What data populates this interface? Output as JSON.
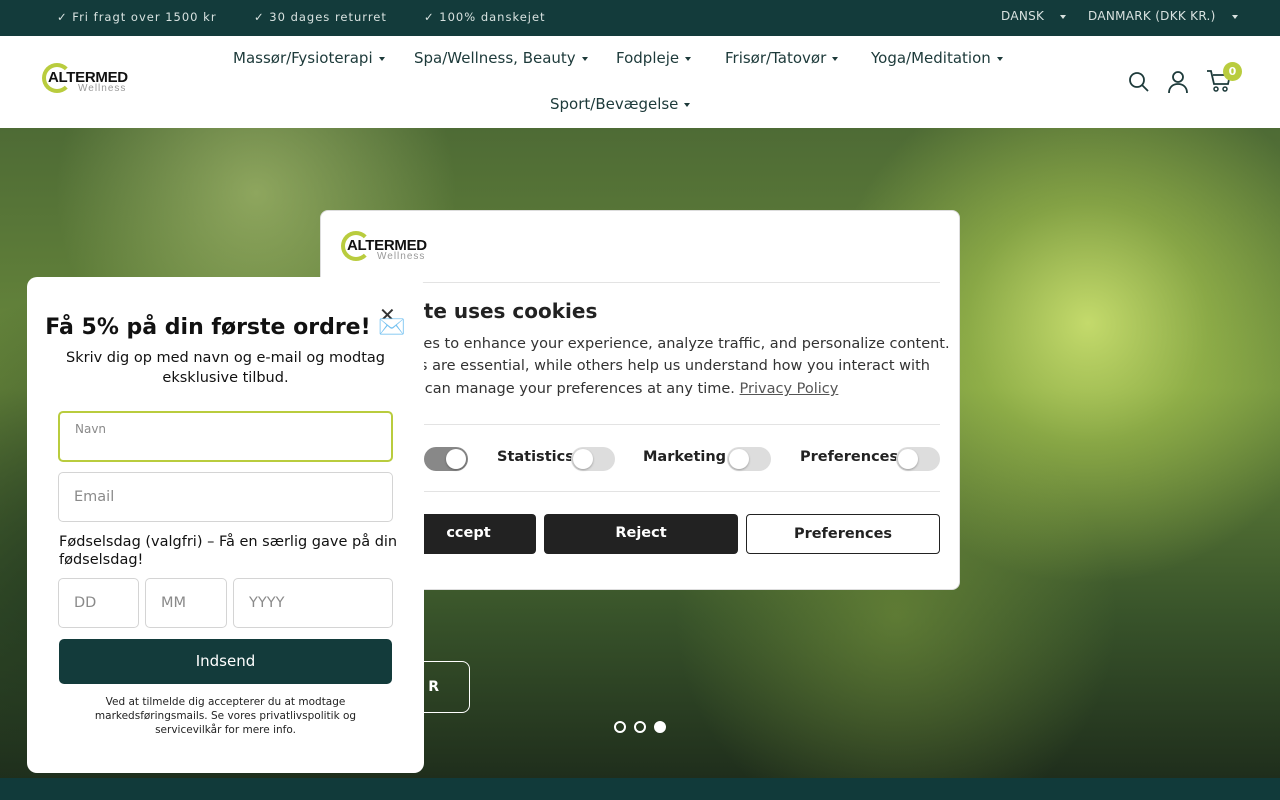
{
  "topbar": {
    "usps": [
      "✓ Fri fragt over 1500 kr",
      "✓ 30 dages returret",
      "✓ 100% danskejet"
    ],
    "language": "DANSK",
    "country": "DANMARK (DKK KR.)"
  },
  "brand": {
    "name": "ALTERMED",
    "tagline": "Wellness"
  },
  "nav": [
    "Massør/Fysioterapi",
    "Spa/Wellness, Beauty",
    "Fodpleje",
    "Frisør/Tatovør",
    "Yoga/Meditation",
    "Sport/Bevægelse"
  ],
  "cart": {
    "count": "0"
  },
  "hero": {
    "button_fragment": "R",
    "slides": 3,
    "active_slide": 3
  },
  "cookie": {
    "title_visible": "site uses cookies",
    "lines_visible": [
      "kies to enhance your experience, analyze traffic, and personalize content.",
      "es are essential, while others help us understand how you interact with",
      "u can manage your preferences at any time."
    ],
    "privacy_link": "Privacy Policy",
    "toggles": [
      {
        "label": "Statistics",
        "on": false
      },
      {
        "label": "Marketing",
        "on": false
      },
      {
        "label": "Preferences",
        "on": false
      }
    ],
    "accept_visible": "ccept",
    "reject": "Reject",
    "preferences": "Preferences"
  },
  "newsletter": {
    "title": "Få 5% på din første ordre! ✉️",
    "subtitle": "Skriv dig op med navn og e-mail og modtag eksklusive tilbud.",
    "name_label": "Navn",
    "email_placeholder": "Email",
    "birthday_label": "Fødselsdag (valgfri) – Få en særlig gave på din fødselsdag!",
    "dd": "DD",
    "mm": "MM",
    "yyyy": "YYYY",
    "submit": "Indsend",
    "legal": "Ved at tilmelde dig accepterer du at modtage markedsføringsmails. Se vores privatlivspolitik og servicevilkår for mere info.",
    "close": "✕"
  },
  "colors": {
    "dark": "#133b3b",
    "accent": "#b9cc3e"
  }
}
